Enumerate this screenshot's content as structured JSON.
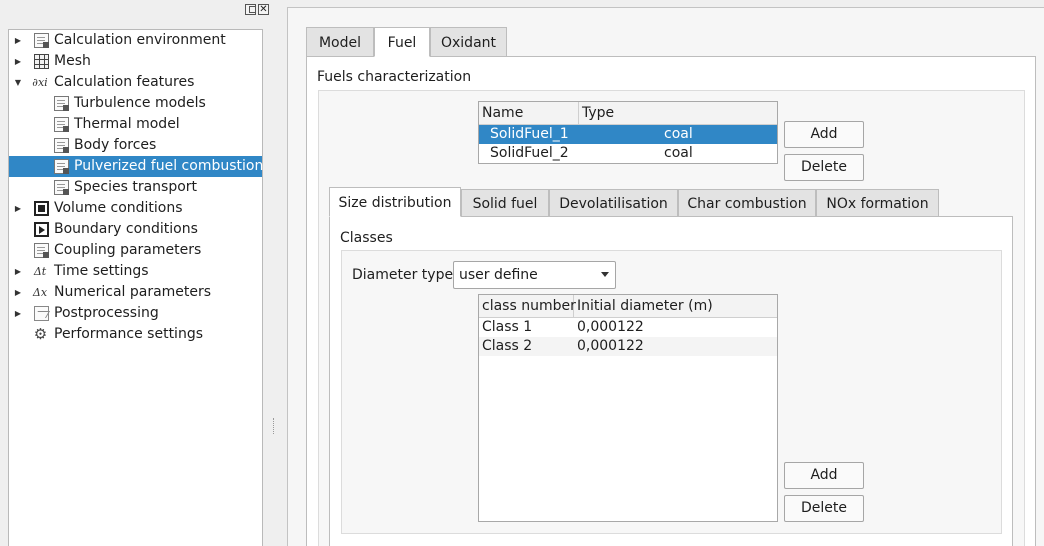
{
  "dock": {
    "float_icon": "float-icon",
    "close_glyph": "✕"
  },
  "tree": {
    "items": [
      {
        "label": "Calculation environment",
        "icon": "document-icon",
        "expander": "▶"
      },
      {
        "label": "Mesh",
        "icon": "mesh-icon",
        "expander": "▶"
      },
      {
        "label": "Calculation features",
        "icon": "formula-icon",
        "icon_text": "∂xi",
        "expander": "▼"
      },
      {
        "label": "Turbulence models",
        "icon": "document-icon"
      },
      {
        "label": "Thermal model",
        "icon": "document-icon"
      },
      {
        "label": "Body forces",
        "icon": "document-icon"
      },
      {
        "label": "Pulverized fuel combustion",
        "icon": "document-icon",
        "selected": true
      },
      {
        "label": "Species transport",
        "icon": "document-icon"
      },
      {
        "label": "Volume conditions",
        "icon": "volume-icon",
        "expander": "▶"
      },
      {
        "label": "Boundary conditions",
        "icon": "boundary-icon"
      },
      {
        "label": "Coupling parameters",
        "icon": "document-icon"
      },
      {
        "label": "Time settings",
        "icon": "delta-t-icon",
        "icon_text": "Δt",
        "expander": "▶"
      },
      {
        "label": "Numerical parameters",
        "icon": "delta-x-icon",
        "icon_text": "Δx",
        "expander": "▶"
      },
      {
        "label": "Postprocessing",
        "icon": "chart-icon",
        "expander": "▶"
      },
      {
        "label": "Performance settings",
        "icon": "gear-icon",
        "icon_text": "⚙"
      }
    ]
  },
  "main_tabs": [
    {
      "label": "Model"
    },
    {
      "label": "Fuel",
      "active": true
    },
    {
      "label": "Oxidant"
    }
  ],
  "fuels": {
    "section_title": "Fuels characterization",
    "columns": [
      "Name",
      "Type"
    ],
    "rows": [
      {
        "name": "SolidFuel_1",
        "type": "coal",
        "selected": true
      },
      {
        "name": "SolidFuel_2",
        "type": "coal"
      }
    ],
    "add_label": "Add",
    "delete_label": "Delete"
  },
  "sub_tabs": [
    {
      "label": "Size distribution",
      "active": true
    },
    {
      "label": "Solid fuel"
    },
    {
      "label": "Devolatilisation"
    },
    {
      "label": "Char combustion"
    },
    {
      "label": "NOx formation"
    }
  ],
  "classes": {
    "section_title": "Classes",
    "diameter_type_label": "Diameter type",
    "diameter_type_value": "user define",
    "columns": [
      "class number",
      "Initial diameter (m)"
    ],
    "rows": [
      {
        "class": "Class 1",
        "diameter": "0,000122"
      },
      {
        "class": "Class 2",
        "diameter": "0,000122"
      }
    ],
    "add_label": "Add",
    "delete_label": "Delete"
  },
  "colors": {
    "selection": "#3087c6",
    "background": "#efefef",
    "panel": "#ffffff"
  }
}
